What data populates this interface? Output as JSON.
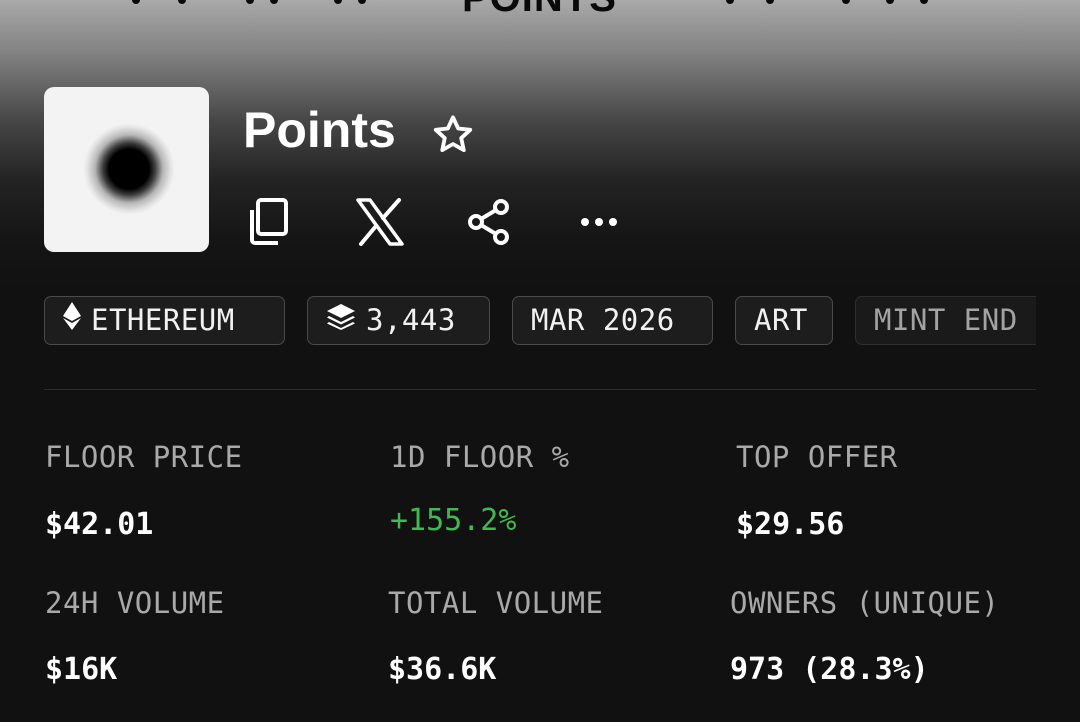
{
  "banner": {
    "title": "POINTS"
  },
  "collection": {
    "name": "Points",
    "chips": [
      {
        "icon": "ethereum-icon",
        "label": "ETHEREUM"
      },
      {
        "icon": "layers-icon",
        "label": "3,443"
      },
      {
        "label": "MAR 2026"
      },
      {
        "label": "ART"
      },
      {
        "label": "MINT END"
      }
    ]
  },
  "actions": [
    "copy-icon",
    "x-logo-icon",
    "share-icon",
    "more-icon"
  ],
  "stats": {
    "floor_price": {
      "label": "FLOOR PRICE",
      "value": "$42.01"
    },
    "floor_change": {
      "label": "1D FLOOR %",
      "value": "+155.2%"
    },
    "top_offer": {
      "label": "TOP OFFER",
      "value": "$29.56"
    },
    "volume_24h": {
      "label": "24H VOLUME",
      "value": "$16K"
    },
    "total_volume": {
      "label": "TOTAL VOLUME",
      "value": "$36.6K"
    },
    "owners": {
      "label": "OWNERS (UNIQUE)",
      "value": "973 (28.3%)"
    }
  },
  "colors": {
    "positive": "#3fb950",
    "background": "#111111",
    "muted_text": "#a9a9a9"
  }
}
